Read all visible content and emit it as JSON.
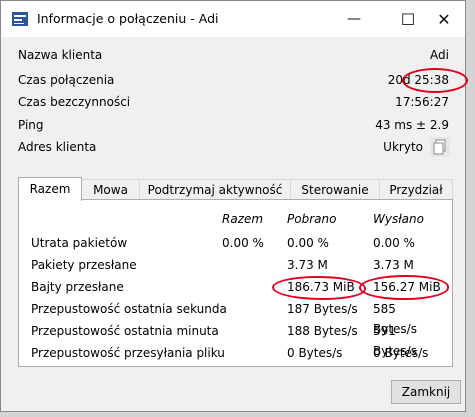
{
  "window": {
    "title": "Informacje o połączeniu - Adi"
  },
  "controls": {
    "minimize": "—",
    "maximize": "☐",
    "close": "✕"
  },
  "info": [
    {
      "label": "Nazwa klienta",
      "value": "Adi"
    },
    {
      "label": "Czas połączenia",
      "value": "20d 25:38"
    },
    {
      "label": "Czas bezczynności",
      "value": "17:56:27"
    },
    {
      "label": "Ping",
      "value": "43 ms ± 2.9"
    },
    {
      "label": "Adres klienta",
      "value": "Ukryto"
    }
  ],
  "tabs": [
    "Razem",
    "Mowa",
    "Podtrzymaj aktywność",
    "Sterowanie",
    "Przydział"
  ],
  "active_tab": "Razem",
  "table": {
    "headers": [
      "Razem",
      "Pobrano",
      "Wysłano"
    ],
    "rows": [
      {
        "label": "Utrata pakietów",
        "razem": "0.00 %",
        "pobrano": "0.00 %",
        "wyslano": "0.00 %"
      },
      {
        "label": "Pakiety przesłane",
        "razem": "",
        "pobrano": "3.73 M",
        "wyslano": "3.73 M"
      },
      {
        "label": "Bajty przesłane",
        "razem": "",
        "pobrano": "186.73 MiB",
        "wyslano": "156.27 MiB"
      },
      {
        "label": "Przepustowość ostatnia sekunda",
        "razem": "",
        "pobrano": "187 Bytes/s",
        "wyslano": "585 Bytes/s"
      },
      {
        "label": "Przepustowość ostatnia minuta",
        "razem": "",
        "pobrano": "188 Bytes/s",
        "wyslano": "591 Bytes/s"
      },
      {
        "label": "Przepustowość przesyłania pliku",
        "razem": "",
        "pobrano": "0 Bytes/s",
        "wyslano": "0 Bytes/s"
      }
    ]
  },
  "buttons": {
    "close_label": "Zamknij"
  },
  "colors": {
    "annotation": "#e0001b"
  }
}
